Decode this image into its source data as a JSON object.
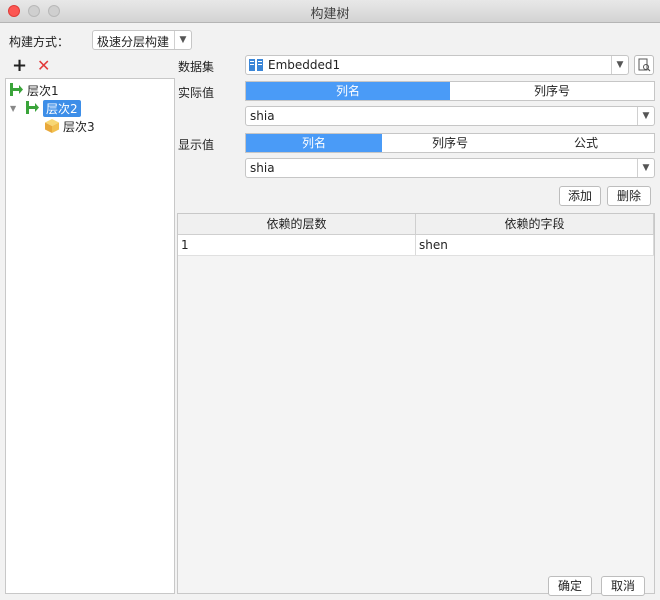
{
  "window": {
    "title": "构建树"
  },
  "build_mode": {
    "label": "构建方式：",
    "value": "极速分层构建"
  },
  "toolbar": {
    "add": "+",
    "delete": "✕"
  },
  "tree": {
    "nodes": [
      {
        "label": "层次1"
      },
      {
        "label": "层次2"
      },
      {
        "label": "层次3"
      }
    ]
  },
  "dataset": {
    "label": "数据集",
    "value": "Embedded1"
  },
  "actual_value": {
    "label": "实际值",
    "tabs": [
      "列名",
      "列序号"
    ],
    "field": "shia"
  },
  "display_value": {
    "label": "显示值",
    "tabs": [
      "列名",
      "列序号",
      "公式"
    ],
    "field": "shia"
  },
  "actions": {
    "add": "添加",
    "delete": "删除"
  },
  "table": {
    "columns": [
      "依赖的层数",
      "依赖的字段"
    ],
    "rows": [
      [
        "1",
        "shen"
      ]
    ]
  },
  "footer": {
    "ok": "确定",
    "cancel": "取消"
  }
}
